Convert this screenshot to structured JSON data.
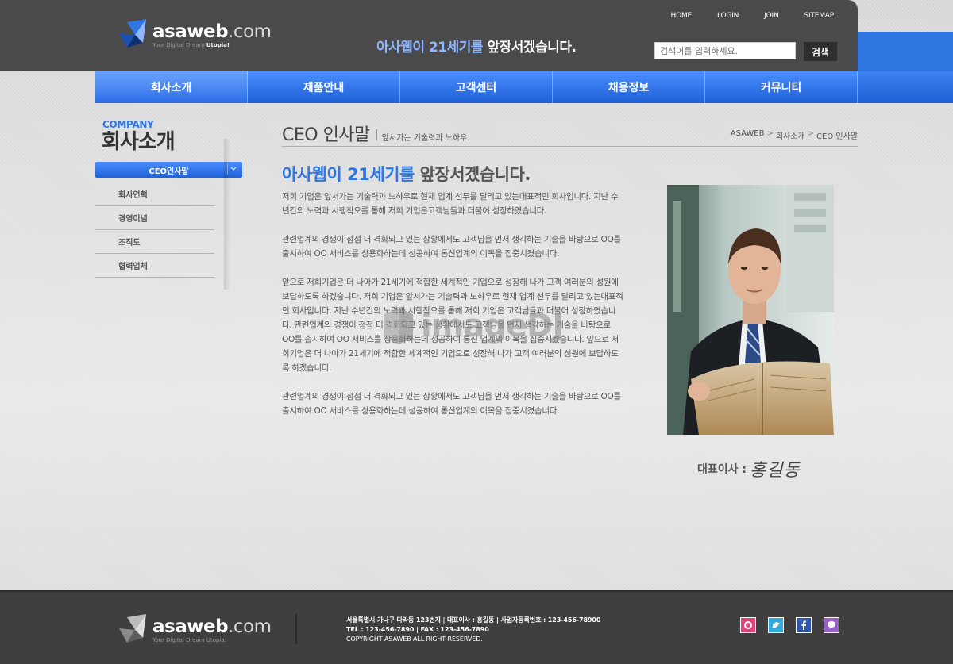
{
  "header": {
    "brand": "asaweb",
    "brand_suffix": ".com",
    "tagline": "Your Digital Dream",
    "tagline_bold": "Utopia!",
    "top_nav": [
      "HOME",
      "LOGIN",
      "JOIN",
      "SITEMAP"
    ],
    "slogan_highlight": "아사웹이 21세기를",
    "slogan_rest": " 앞장서겠습니다.",
    "search_placeholder": "검색어를 입력하세요.",
    "search_button": "검색"
  },
  "gnb": [
    "회사소개",
    "제품안내",
    "고객센터",
    "채용정보",
    "커뮤니티"
  ],
  "side": {
    "title_en": "COMPANY",
    "title_ko": "회사소개",
    "active": "CEO인사말",
    "items": [
      "회사연혁",
      "경영이념",
      "조직도",
      "협력업체"
    ]
  },
  "content": {
    "title": "CEO 인사말",
    "subtitle": "앞서가는 기술력과 노하우.",
    "breadcrumb": [
      "ASAWEB",
      "회사소개",
      "CEO 인사말"
    ],
    "headline_highlight": "아사웹이 21세기를",
    "headline_rest": " 앞장서겠습니다.",
    "paragraphs": [
      "저희 기업은 앞서가는 기술력과 노하우로 현재 업계 선두를 달리고 있는대표적인 회사입니다. 지난 수년간의 노력과 시행착오를 통해 저희 기업은고객님들과 더불어 성장하였습니다.",
      "관련업계의 경쟁이 점점 더 격화되고 있는 상황에서도 고객님을 먼저 생각하는 기술을 바탕으로 OO를 출시하여 OO 서비스를 상용화하는데 성공하여 통신업계의 이목을 집중시켰습니다.",
      "앞으로 저희기업은 더 나아가 21세기에 적합한 세계적인 기업으로 성장해 나가 고객 여러분의 성원에 보답하도록 하겠습니다. 저희 기업은 앞서가는 기술력과 노하우로 현재 업계 선두를 달리고 있는대표적인 회사입니다. 지난 수년간의 노력과 시행착오를 통해 저희 기업은 고객님들과 더불어 성장하였습니다. 관련업계의 경쟁이 점점 더 격화되고 있는 상황에서도 고객님을 먼저 생각하는 기술을 바탕으로 OO를 출시하여 OO 서비스를 상용화하는데 성공하여 통신 업계의 이목을 집중시켰습니다. 앞으로 저희기업은 더 나아가 21세기에 적합한 세계적인 기업으로 성장해 나가 고객 여러분의 성원에 보답하도록 하겠습니다.",
      "관련업계의 경쟁이 점점 더 격화되고 있는 상황에서도 고객님을 먼저 생각하는 기술을 바탕으로 OO를 출시하여 OO 서비스를 상용화하는데 성공하여 통신업계의 이목을 집중시켰습니다."
    ],
    "caption_label": "대표이사 :",
    "caption_signature": "홍길동",
    "watermark": "imageDJ"
  },
  "footer": {
    "line1": "서울특별시 가나구 다라동 123번지  |  대표이사 : 홍길동  |  사업자등록번호 : 123-456-78900",
    "line2": "TEL : 123-456-7890  |  FAX : 123-456-7890",
    "line3": "COPYRIGHT ASAWEB ALL RIGHT RESERVED.",
    "social": [
      "kakao-icon",
      "twitter-icon",
      "facebook-icon",
      "message-icon"
    ]
  },
  "colors": {
    "accent": "#2f76e0",
    "header_bg": "#4a4a4a",
    "footer_bg": "#3f3f3f"
  }
}
